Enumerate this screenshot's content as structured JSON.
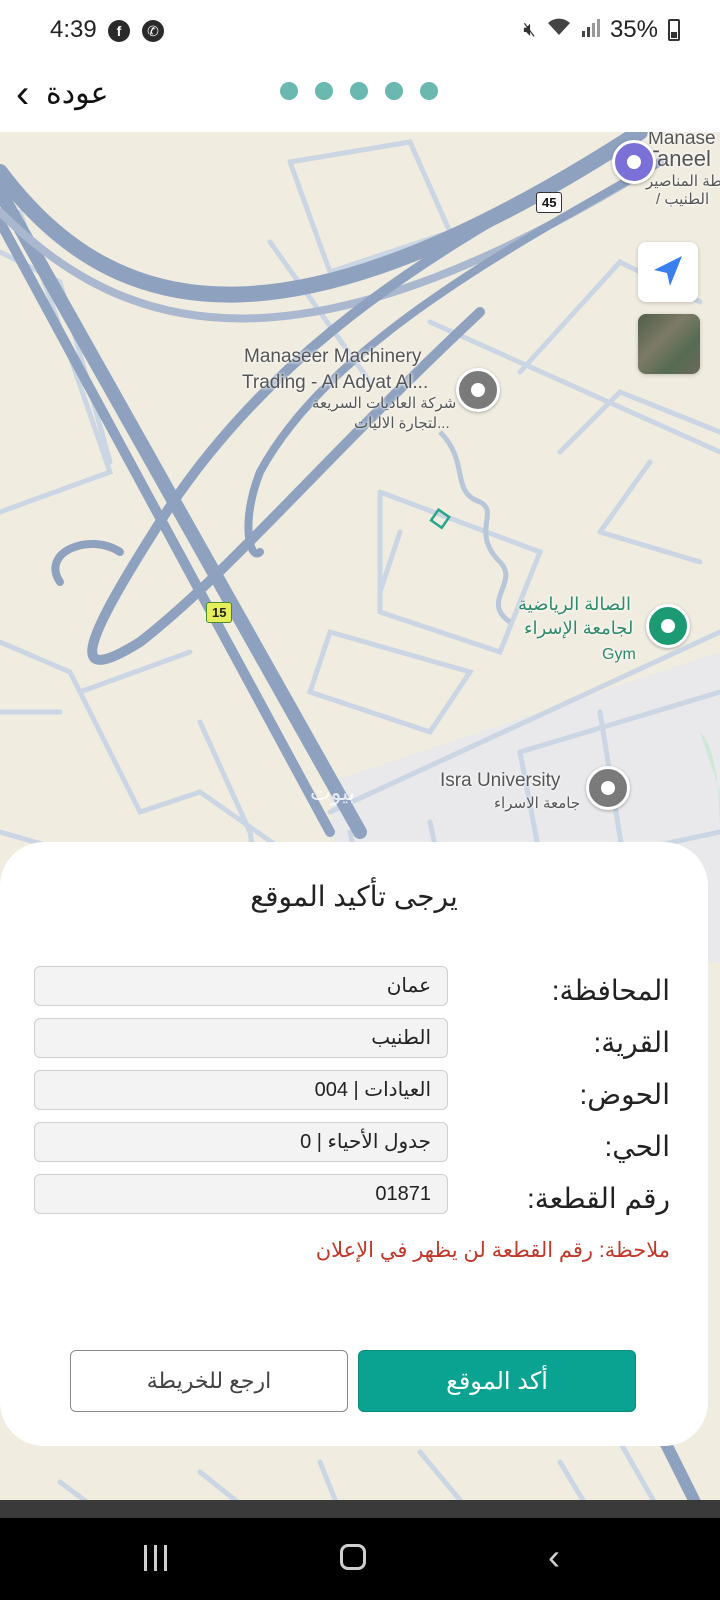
{
  "status_bar": {
    "time": "4:39",
    "battery": "35%",
    "left_icons": [
      "facebook-icon",
      "messenger-icon"
    ],
    "right_icons": [
      "mute-icon",
      "wifi-icon",
      "signal-icon",
      "battery-icon"
    ]
  },
  "header": {
    "back_label": "عودة",
    "progress_step_count": 5
  },
  "map": {
    "labels": {
      "manaseer_top": "Manase",
      "taneeb_top": "Taneel",
      "ar_top_1": "محطة المناصير",
      "ar_top_2": "/ الطنيب",
      "manaseer_en_1": "Manaseer Machinery",
      "manaseer_en_2": "Trading - Al Adyat Al...",
      "manaseer_ar_1": "شركة العاديات السريعة",
      "manaseer_ar_2": "لتجارة الاليات...",
      "gym_ar_1": "الصالة الرياضية",
      "gym_ar_2": "لجامعة الإسراء",
      "gym_en": "Gym",
      "isra_en": "Isra University",
      "isra_ar": "جامعة الاسراء",
      "watermark": "بيوت"
    },
    "road_shields": [
      "45",
      "15"
    ],
    "colors": {
      "highway": "#8ea2c0",
      "road": "#c9d5e2",
      "gym_pin": "#1c9a73",
      "fuel_pin": "#7a70d8",
      "generic_pin": "#7a7a7a",
      "parcel": "#2aa58a"
    }
  },
  "card": {
    "title": "يرجى تأكيد الموقع",
    "fields": [
      {
        "label": "المحافظة:",
        "value": "عمان"
      },
      {
        "label": "القرية:",
        "value": "الطنيب"
      },
      {
        "label": "الحوض:",
        "value": "العيادات | 004"
      },
      {
        "label": "الحي:",
        "value": "جدول الأحياء | 0"
      },
      {
        "label": "رقم القطعة:",
        "value": "01871"
      }
    ],
    "note": "ملاحظة: رقم القطعة لن يظهر في الإعلان",
    "confirm_button": "أكد الموقع",
    "back_to_map_button": "ارجع للخريطة"
  },
  "nav_bar": {
    "icons": [
      "recent-apps-icon",
      "home-icon",
      "back-icon"
    ]
  }
}
